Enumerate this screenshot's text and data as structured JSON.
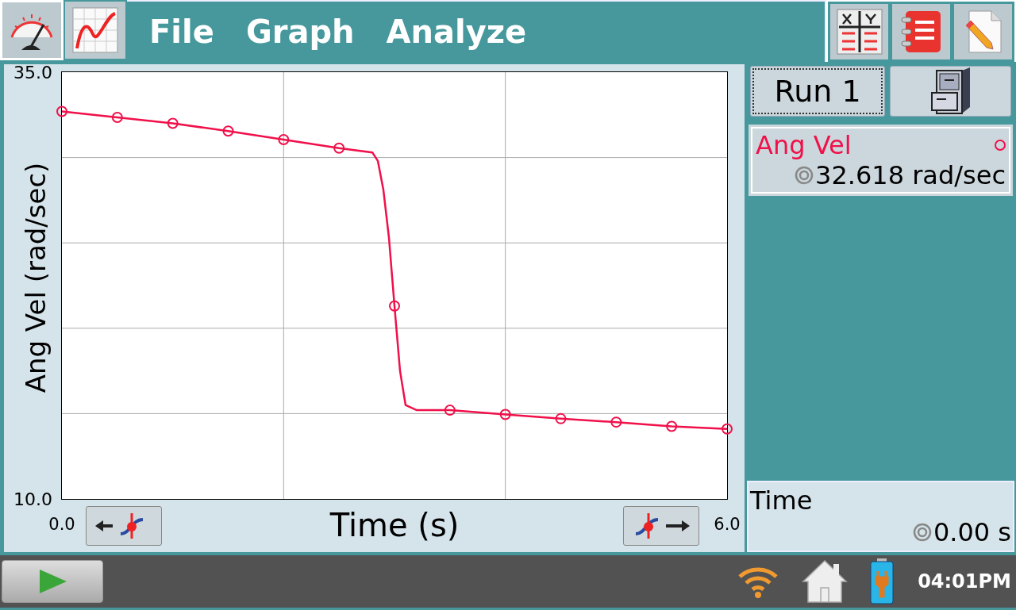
{
  "toolbar": {
    "view_buttons": [
      {
        "kind": "meter",
        "selected": true
      },
      {
        "kind": "graph",
        "selected": false
      }
    ],
    "menu": [
      "File",
      "Graph",
      "Analyze"
    ],
    "tool_buttons": [
      {
        "kind": "table"
      },
      {
        "kind": "notebook"
      },
      {
        "kind": "document"
      }
    ]
  },
  "graph": {
    "chart_data": {
      "type": "line",
      "xlabel": "Time (s)",
      "ylabel": "Ang Vel (rad/sec)",
      "xlim": [
        0,
        6
      ],
      "ylim": [
        10,
        35
      ],
      "xticks": [
        {
          "value": 0,
          "label": "0.0"
        },
        {
          "value": 6,
          "label": "6.0"
        }
      ],
      "yticks": [
        {
          "value": 10,
          "label": "10.0"
        },
        {
          "value": 35,
          "label": "35.0"
        }
      ],
      "x": [
        0,
        0.5,
        1,
        1.5,
        2,
        2.5,
        2.8,
        2.85,
        2.9,
        2.95,
        3,
        3.05,
        3.1,
        3.2,
        3.5,
        4,
        4.5,
        5,
        5.5,
        6
      ],
      "series": [
        {
          "color": "#f0104a",
          "values": [
            32.7,
            32.35,
            32.0,
            31.55,
            31.05,
            30.55,
            30.3,
            29.8,
            28.1,
            25.3,
            21.3,
            17.5,
            15.5,
            15.2,
            15.2,
            14.95,
            14.7,
            14.5,
            14.25,
            14.1
          ]
        }
      ]
    }
  },
  "side": {
    "run_button": "Run 1",
    "meters": [
      {
        "name": "Ang Vel",
        "color": "#f0104a",
        "value": "32.618 rad/sec"
      }
    ],
    "time_meter": {
      "name": "Time",
      "value": "0.00 s"
    }
  },
  "taskbar": {
    "clock": "04:01PM"
  }
}
